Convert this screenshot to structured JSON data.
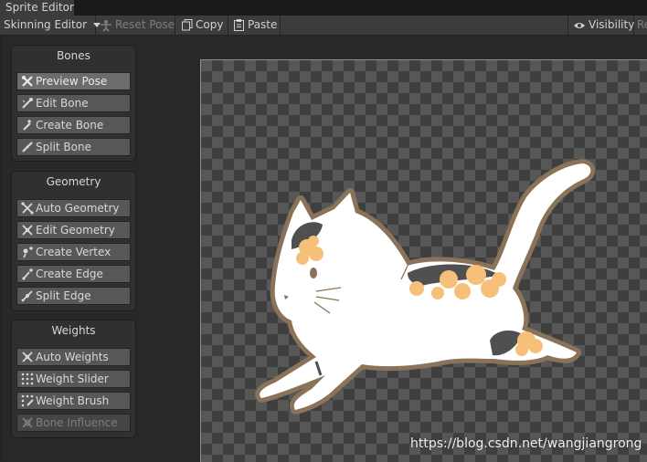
{
  "window": {
    "tab_title": "Sprite Editor"
  },
  "toolbar": {
    "mode_dropdown": "Skinning Editor",
    "reset_pose": "Reset Pose",
    "copy": "Copy",
    "paste": "Paste",
    "visibility": "Visibility",
    "cut_right": "Re"
  },
  "panels": {
    "bones": {
      "title": "Bones",
      "buttons": [
        "Preview Pose",
        "Edit Bone",
        "Create Bone",
        "Split Bone"
      ]
    },
    "geometry": {
      "title": "Geometry",
      "buttons": [
        "Auto Geometry",
        "Edit Geometry",
        "Create Vertex",
        "Create Edge",
        "Split Edge"
      ]
    },
    "weights": {
      "title": "Weights",
      "buttons": [
        "Auto Weights",
        "Weight Slider",
        "Weight Brush",
        "Bone Influence"
      ]
    }
  },
  "sprite": {
    "subject": "cat-sprite"
  },
  "watermark": "https://blog.csdn.net/wangjiangrong",
  "colors": {
    "accent_patch": "#f7c07a",
    "dark_patch": "#505050",
    "outline": "#8a7358",
    "body": "#ffffff"
  }
}
